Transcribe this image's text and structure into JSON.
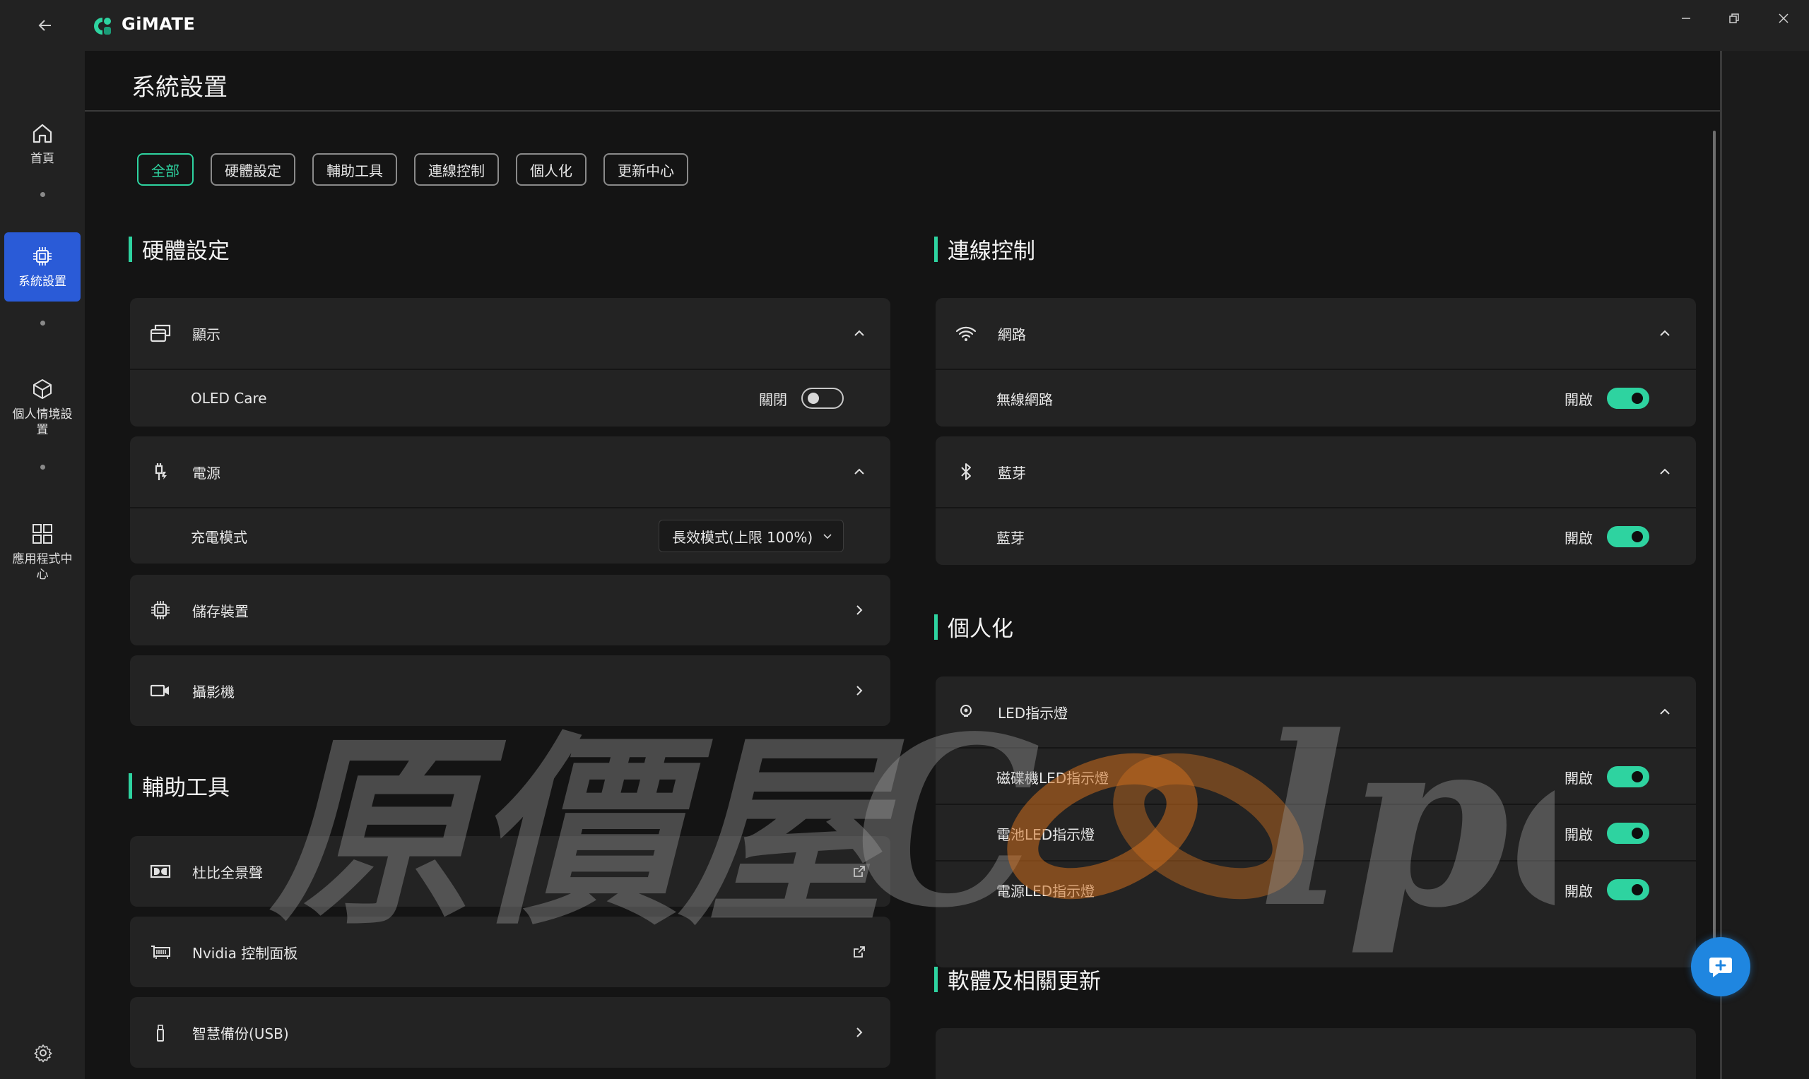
{
  "app": {
    "name": "GiMATE"
  },
  "nav": {
    "items": [
      {
        "label": "首頁",
        "icon": "home-icon"
      },
      {
        "label": "系統設置",
        "icon": "chip-icon",
        "active": true
      },
      {
        "label": "個人情境設置",
        "icon": "cube-icon"
      },
      {
        "label": "應用程式中心",
        "icon": "apps-grid-icon"
      }
    ],
    "settings_icon": "gear-icon"
  },
  "page": {
    "title": "系統設置"
  },
  "filters": [
    "全部",
    "硬體設定",
    "輔助工具",
    "連線控制",
    "個人化",
    "更新中心"
  ],
  "filters_active": "全部",
  "hardware": {
    "title": "硬體設定",
    "display": {
      "title": "顯示",
      "row_label": "OLED Care",
      "state": "關閉",
      "toggle": false
    },
    "power": {
      "title": "電源",
      "row_label": "充電模式",
      "select_value": "長效模式(上限 100%)"
    },
    "storage": {
      "title": "儲存裝置"
    },
    "camera": {
      "title": "攝影機"
    }
  },
  "tools": {
    "title": "輔助工具",
    "dolby": {
      "title": "杜比全景聲"
    },
    "nvidia": {
      "title": "Nvidia 控制面板"
    },
    "backup": {
      "title": "智慧備份(USB)"
    }
  },
  "connection": {
    "title": "連線控制",
    "network": {
      "title": "網路",
      "row_label": "無線網路",
      "state": "開啟",
      "toggle": true
    },
    "bluetooth": {
      "title": "藍芽",
      "row_label": "藍芽",
      "state": "開啟",
      "toggle": true
    }
  },
  "personal": {
    "title": "個人化",
    "led": {
      "title": "LED指示燈",
      "rows": [
        {
          "label": "磁碟機LED指示燈",
          "state": "開啟",
          "toggle": true
        },
        {
          "label": "電池LED指示燈",
          "state": "開啟",
          "toggle": true
        },
        {
          "label": "電源LED指示燈",
          "state": "開啟",
          "toggle": true
        }
      ]
    }
  },
  "updates": {
    "title": "軟體及相關更新"
  },
  "watermark": {
    "text": "原價屋Coolpc"
  },
  "colors": {
    "accent": "#2ed3a0",
    "nav_active": "#2a5bd7",
    "fab": "#1f86e0"
  }
}
